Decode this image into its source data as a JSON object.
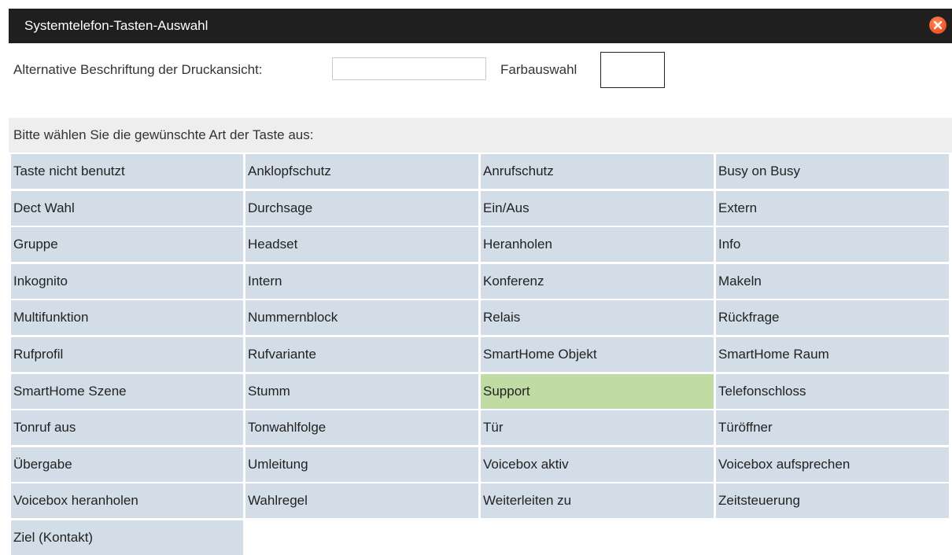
{
  "dialog": {
    "title": "Systemtelefon-Tasten-Auswahl",
    "close_icon": "close-circle-icon",
    "close_color": "#f05a28"
  },
  "options": {
    "print_label": "Alternative Beschriftung der Druckansicht:",
    "print_value": "",
    "color_label": "Farbauswahl",
    "color_value": "#ffffff"
  },
  "instruction": "Bitte wählen Sie die gewünschte Art der Taste aus:",
  "colors": {
    "titlebar": "#1f1f1f",
    "key_background": "#d3dde8",
    "key_selected": "#c1dba4",
    "instruction_background": "#eeeeee"
  },
  "selected_key": "Support",
  "keys": [
    "Taste nicht benutzt",
    "Anklopfschutz",
    "Anrufschutz",
    "Busy on Busy",
    "Dect Wahl",
    "Durchsage",
    "Ein/Aus",
    "Extern",
    "Gruppe",
    "Headset",
    "Heranholen",
    "Info",
    "Inkognito",
    "Intern",
    "Konferenz",
    "Makeln",
    "Multifunktion",
    "Nummernblock",
    "Relais",
    "Rückfrage",
    "Rufprofil",
    "Rufvariante",
    "SmartHome Objekt",
    "SmartHome Raum",
    "SmartHome Szene",
    "Stumm",
    "Support",
    "Telefonschloss",
    "Tonruf aus",
    "Tonwahlfolge",
    "Tür",
    "Türöffner",
    "Übergabe",
    "Umleitung",
    "Voicebox aktiv",
    "Voicebox aufsprechen",
    "Voicebox heranholen",
    "Wahlregel",
    "Weiterleiten zu",
    "Zeitsteuerung",
    "Ziel (Kontakt)"
  ]
}
